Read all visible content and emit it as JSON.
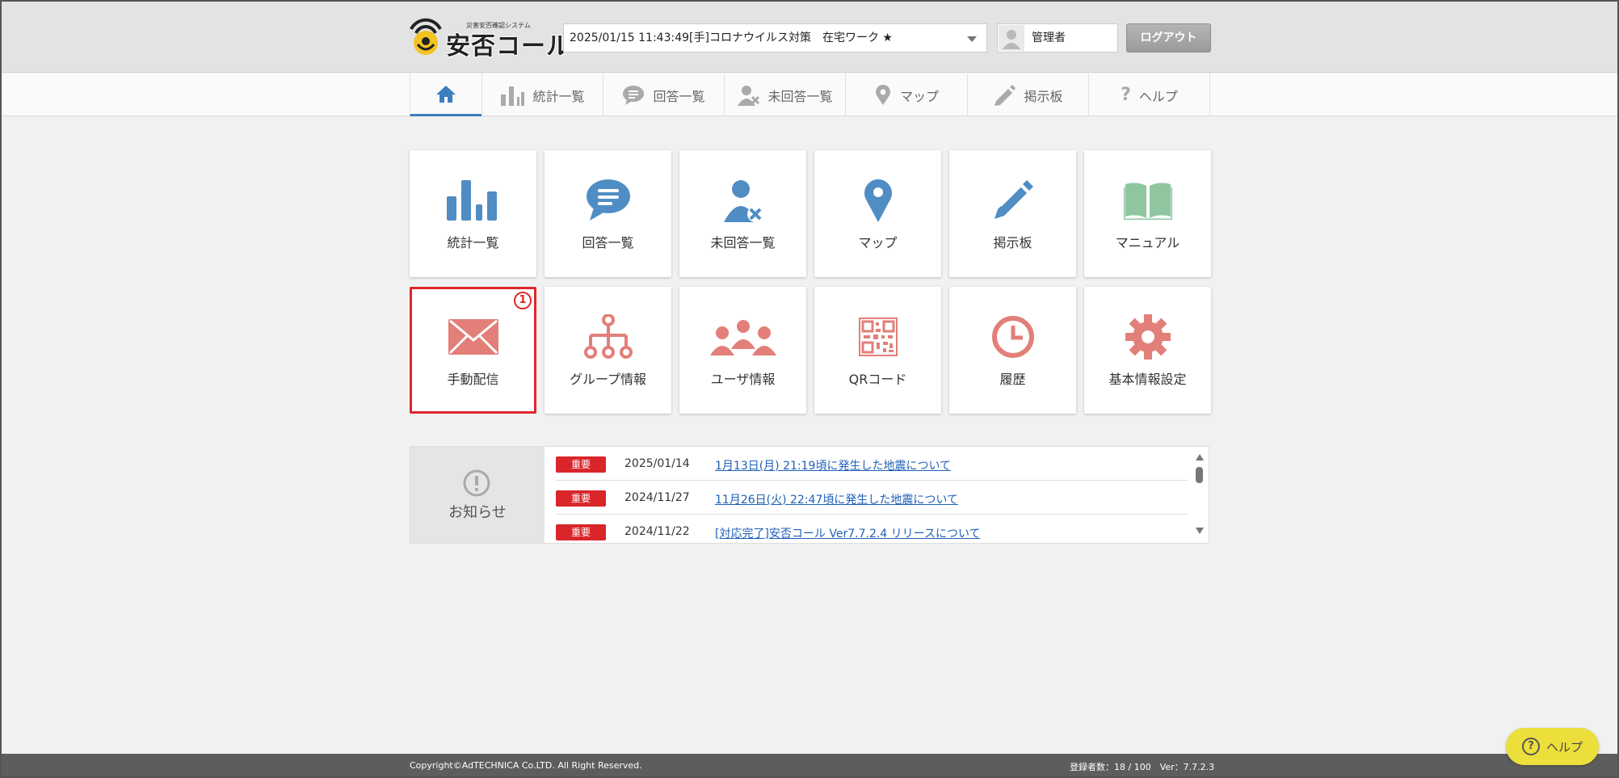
{
  "header": {
    "logo_sub": "災害安否確認システム",
    "logo_text": "安否コール",
    "situation": "2025/01/15 11:43:49[手]コロナウイルス対策　在宅ワーク ★",
    "user_name": "管理者",
    "logout_label": "ログアウト"
  },
  "nav": {
    "tabs": [
      {
        "label": "",
        "icon": "home-icon"
      },
      {
        "label": "統計一覧",
        "icon": "bar-chart-icon"
      },
      {
        "label": "回答一覧",
        "icon": "chat-bubble-icon"
      },
      {
        "label": "未回答一覧",
        "icon": "user-x-icon"
      },
      {
        "label": "マップ",
        "icon": "map-pin-icon"
      },
      {
        "label": "掲示板",
        "icon": "pencil-icon"
      },
      {
        "label": "ヘルプ",
        "icon": "question-icon"
      }
    ],
    "active_index": 0
  },
  "tiles": [
    {
      "label": "統計一覧",
      "icon": "bar-chart-icon",
      "color": "#4f8dc4"
    },
    {
      "label": "回答一覧",
      "icon": "chat-bubble-icon",
      "color": "#4f8dc4"
    },
    {
      "label": "未回答一覧",
      "icon": "user-x-icon",
      "color": "#4f8dc4"
    },
    {
      "label": "マップ",
      "icon": "map-pin-icon",
      "color": "#4f8dc4"
    },
    {
      "label": "掲示板",
      "icon": "pencil-icon",
      "color": "#4f8dc4"
    },
    {
      "label": "マニュアル",
      "icon": "book-icon",
      "color": "#8fc6a0"
    },
    {
      "label": "手動配信",
      "icon": "envelope-icon",
      "color": "#e27f78",
      "badge": "1"
    },
    {
      "label": "グループ情報",
      "icon": "group-tree-icon",
      "color": "#e27f78"
    },
    {
      "label": "ユーザ情報",
      "icon": "users-icon",
      "color": "#e27f78"
    },
    {
      "label": "QRコード",
      "icon": "qr-code-icon",
      "color": "#e27f78"
    },
    {
      "label": "履歴",
      "icon": "clock-icon",
      "color": "#e27f78"
    },
    {
      "label": "基本情報設定",
      "icon": "gear-icon",
      "color": "#e27f78"
    }
  ],
  "notice": {
    "title": "お知らせ",
    "items": [
      {
        "tag": "重要",
        "date": "2025/01/14",
        "text": "1月13日(月) 21:19頃に発生した地震について"
      },
      {
        "tag": "重要",
        "date": "2024/11/27",
        "text": "11月26日(火) 22:47頃に発生した地震について"
      },
      {
        "tag": "重要",
        "date": "2024/11/22",
        "text": "[対応完了]安否コール Ver7.7.2.4 リリースについて"
      }
    ]
  },
  "footer": {
    "copyright": "Copyright©AdTECHNICA Co.LTD. All Right Reserved.",
    "stats": "登録者数：18 / 100　Ver：7.7.2.3"
  },
  "help_button": {
    "label": "ヘルプ",
    "icon": "question-icon"
  },
  "colors": {
    "accent_blue": "#4f8dc4",
    "accent_red": "#e27f78",
    "accent_green": "#8fc6a0",
    "alert": "#e0262b",
    "help_yellow": "#ecdf3c"
  }
}
